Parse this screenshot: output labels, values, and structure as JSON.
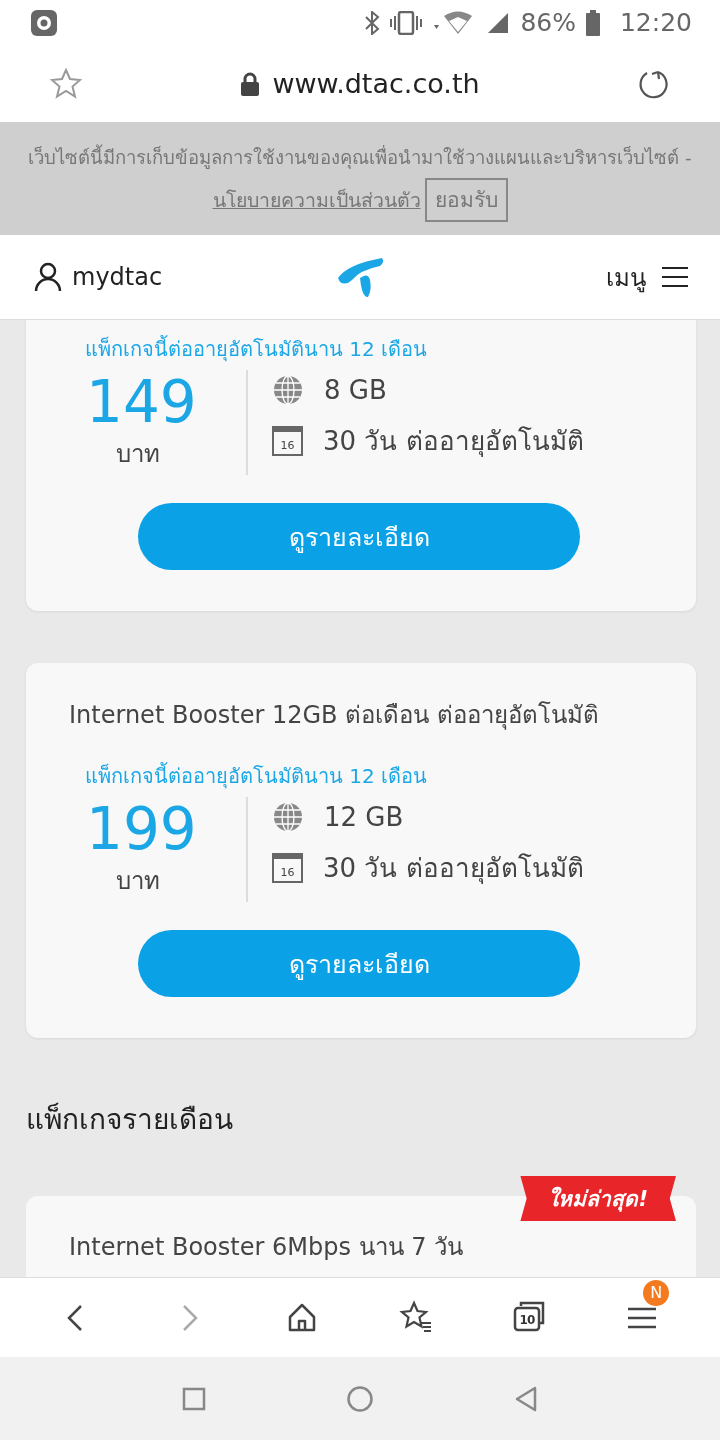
{
  "status_bar": {
    "battery": "86%",
    "time": "12:20"
  },
  "address_bar": {
    "url": "www.dtac.co.th",
    "secure": true
  },
  "cookie_banner": {
    "text": "เว็บไซต์นี้มีการเก็บข้อมูลการใช้งานของคุณเพื่อนำมาใช้วางแผนและบริหารเว็บไซต์ -",
    "link": "นโยบายความเป็นส่วนตัว",
    "accept": "ยอมรับ"
  },
  "site_header": {
    "account": "mydtac",
    "menu": "เมนู"
  },
  "cards": [
    {
      "subtitle": "แพ็กเกจนี้ต่ออายุอัตโนมัตินาน 12 เดือน",
      "price": "149",
      "unit": "บาท",
      "features": [
        {
          "kind": "data",
          "text": "8 GB"
        },
        {
          "kind": "days",
          "text": "30 วัน ต่ออายุอัตโนมัติ",
          "icon_label": "16"
        }
      ],
      "button": "ดูรายละเอียด"
    },
    {
      "title": "Internet Booster 12GB ต่อเดือน ต่ออายุอัตโนมัติ",
      "subtitle": "แพ็กเกจนี้ต่ออายุอัตโนมัตินาน 12 เดือน",
      "price": "199",
      "unit": "บาท",
      "features": [
        {
          "kind": "data",
          "text": "12 GB"
        },
        {
          "kind": "days",
          "text": "30 วัน ต่ออายุอัตโนมัติ",
          "icon_label": "16"
        }
      ],
      "button": "ดูรายละเอียด"
    }
  ],
  "section_heading": "แพ็กเกจรายเดือน",
  "cards_monthly": [
    {
      "title": "Internet Booster 6Mbps นาน 7 วัน",
      "badge": "ใหม่ล่าสุด!"
    }
  ],
  "browser_toolbar": [
    {
      "kind": "back",
      "disabled": false
    },
    {
      "kind": "forward",
      "disabled": true
    },
    {
      "kind": "home",
      "disabled": false
    },
    {
      "kind": "bookmarks",
      "disabled": false
    },
    {
      "kind": "tabs",
      "disabled": false,
      "label": "10"
    },
    {
      "kind": "menu",
      "disabled": false,
      "badge": "N"
    }
  ]
}
